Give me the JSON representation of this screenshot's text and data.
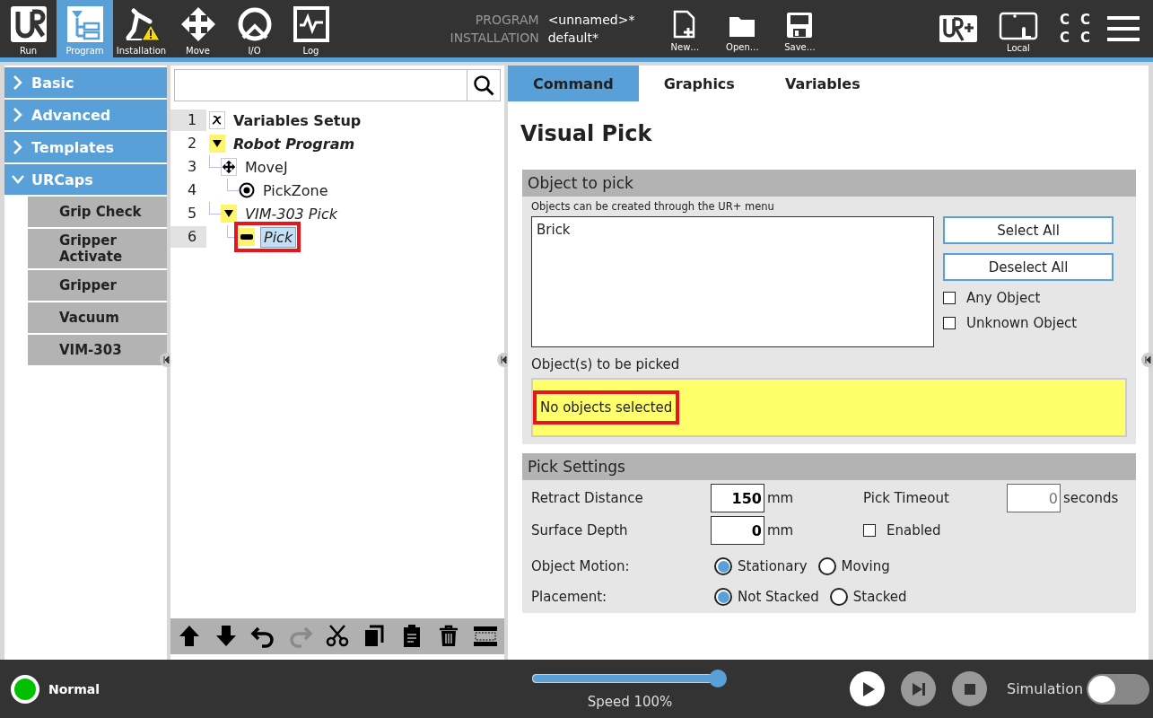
{
  "top_bar": {
    "nav": [
      {
        "kind": "run",
        "label": "Run",
        "selected": false
      },
      {
        "kind": "program",
        "label": "Program",
        "selected": true
      },
      {
        "kind": "installation",
        "label": "Installation",
        "selected": false
      },
      {
        "kind": "move",
        "label": "Move",
        "selected": false
      },
      {
        "kind": "io",
        "label": "I/O",
        "selected": false
      },
      {
        "kind": "log",
        "label": "Log",
        "selected": false
      }
    ],
    "info": [
      {
        "label": "PROGRAM",
        "value": "<unnamed>*"
      },
      {
        "label": "INSTALLATION",
        "value": "default*"
      }
    ],
    "file_buttons": [
      {
        "kind": "new",
        "label": "New…"
      },
      {
        "kind": "open",
        "label": "Open…"
      },
      {
        "kind": "save",
        "label": "Save…"
      }
    ],
    "local": {
      "label": "Local"
    },
    "status_letters": [
      "C",
      "C",
      "C",
      "C"
    ]
  },
  "sidebar": {
    "items": [
      {
        "label": "Basic",
        "expanded": false
      },
      {
        "label": "Advanced",
        "expanded": false
      },
      {
        "label": "Templates",
        "expanded": false
      },
      {
        "label": "URCaps",
        "expanded": true,
        "children": [
          "Grip Check",
          "Gripper Activate",
          "Gripper",
          "Vacuum",
          "VIM-303"
        ]
      }
    ]
  },
  "tree": {
    "nodes": [
      {
        "line": "1",
        "kind": "variables",
        "label": "Variables Setup",
        "bold": true,
        "italic": false,
        "shaded": true,
        "selected": false,
        "highlighted": false
      },
      {
        "line": "2",
        "kind": "folder",
        "label": "Robot Program",
        "bold": true,
        "italic": true,
        "shaded": false,
        "selected": false,
        "highlighted": false,
        "children": [
          {
            "line": "3",
            "kind": "move",
            "label": "MoveJ",
            "bold": false,
            "italic": false,
            "shaded": false,
            "selected": false,
            "highlighted": false,
            "children": [
              {
                "line": "4",
                "kind": "waypoint",
                "label": "PickZone",
                "bold": false,
                "italic": false,
                "shaded": false,
                "selected": false,
                "highlighted": false
              }
            ]
          },
          {
            "line": "5",
            "kind": "folder",
            "label": "VIM-303 Pick",
            "bold": false,
            "italic": true,
            "shaded": false,
            "selected": false,
            "highlighted": false,
            "children": [
              {
                "line": "6",
                "kind": "action",
                "label": "Pick",
                "bold": false,
                "italic": true,
                "shaded": true,
                "selected": true,
                "highlighted": true
              }
            ]
          }
        ]
      }
    ],
    "toolbar": [
      {
        "kind": "up",
        "disabled": false
      },
      {
        "kind": "down",
        "disabled": false
      },
      {
        "kind": "undo",
        "disabled": false
      },
      {
        "kind": "redo",
        "disabled": true
      },
      {
        "kind": "cut",
        "disabled": false
      },
      {
        "kind": "copy",
        "disabled": false
      },
      {
        "kind": "paste",
        "disabled": false
      },
      {
        "kind": "delete",
        "disabled": false
      },
      {
        "kind": "suppress",
        "disabled": false
      }
    ]
  },
  "editor": {
    "tabs": [
      {
        "label": "Command",
        "selected": true
      },
      {
        "label": "Graphics",
        "selected": false
      },
      {
        "label": "Variables",
        "selected": false
      }
    ],
    "title": "Visual Pick",
    "object_to_pick": {
      "heading": "Object to pick",
      "hint": "Objects can be created through the UR+ menu",
      "objects": [
        {
          "label": "Brick",
          "selected": false
        }
      ],
      "buttons": [
        "Select All",
        "Deselect All"
      ],
      "checkboxes": [
        {
          "label": "Any Object",
          "checked": false
        },
        {
          "label": "Unknown Object",
          "checked": false
        }
      ],
      "picked_label": "Object(s) to be picked",
      "picked_text": "No objects selected",
      "picked_highlighted": true
    },
    "pick_settings": {
      "heading": "Pick Settings",
      "fields": [
        {
          "label": "Retract Distance",
          "value": "150",
          "unit": "mm"
        },
        {
          "label": "Surface Depth",
          "value": "0",
          "unit": "mm"
        }
      ],
      "timeout": {
        "label": "Pick Timeout",
        "value": "0",
        "unit": "seconds",
        "disabled": true
      },
      "enabled": {
        "label": "Enabled",
        "checked": false
      },
      "radio_groups": [
        {
          "label": "Object Motion:",
          "options": [
            {
              "label": "Stationary",
              "selected": true
            },
            {
              "label": "Moving",
              "selected": false
            }
          ]
        },
        {
          "label": "Placement:",
          "options": [
            {
              "label": "Not Stacked",
              "selected": true
            },
            {
              "label": "Stacked",
              "selected": false
            }
          ]
        }
      ]
    }
  },
  "bottom_bar": {
    "status": {
      "label": "Normal",
      "color": "#00c000"
    },
    "speed": {
      "level": 1.0,
      "reading": "Speed 100%"
    },
    "controls": [
      {
        "kind": "play",
        "disabled": false
      },
      {
        "kind": "step",
        "disabled": true
      },
      {
        "kind": "stop",
        "disabled": true
      }
    ],
    "simulation": {
      "label": "Simulation",
      "on": false
    }
  }
}
